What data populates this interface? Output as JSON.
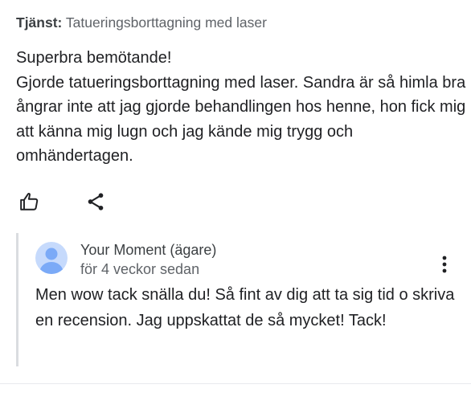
{
  "review": {
    "service_label": "Tjänst:",
    "service_value": "Tatueringsborttagning med laser",
    "text_line1": "Superbra bemötande!",
    "text_body": "Gjorde tatueringsborttagning med laser. Sandra är så himla bra ångrar inte att jag gjorde behandlingen hos henne, hon fick mig att känna mig lugn och jag kände mig trygg och omhändertagen."
  },
  "actions": {
    "like_icon": "thumb-up-icon",
    "share_icon": "share-icon"
  },
  "reply": {
    "owner_name": "Your Moment (ägare)",
    "date": "för 4 veckor sedan",
    "text": "Men wow tack snälla du! Så fint av dig att ta sig tid o skriva en recension. Jag uppskattat de så mycket! Tack!",
    "menu_icon": "more-vert-icon",
    "avatar_icon": "person-avatar-icon"
  },
  "colors": {
    "text_primary": "#202124",
    "text_secondary": "#5f6368",
    "avatar_bg": "#c6dafc",
    "avatar_fg": "#7baaf7",
    "reply_border": "#dadce0"
  }
}
